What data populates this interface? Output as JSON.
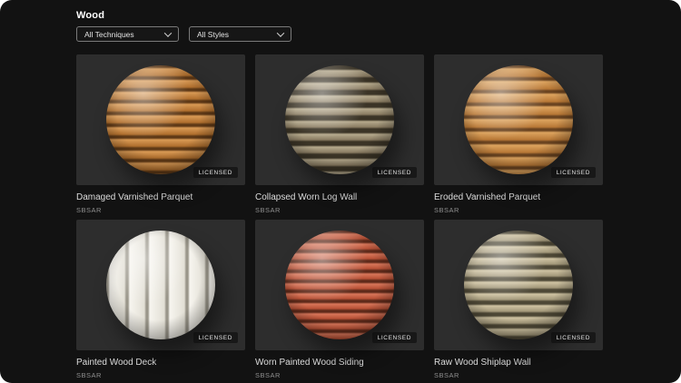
{
  "header": {
    "title": "Wood"
  },
  "filters": {
    "techniques": {
      "label": "All Techniques"
    },
    "styles": {
      "label": "All Styles"
    }
  },
  "cards": [
    {
      "title": "Damaged Varnished Parquet",
      "format": "SBSAR",
      "badge": "LICENSED",
      "sphere": {
        "light": "#d99a55",
        "base": "#b06f2e",
        "dark": "#5f3916",
        "direction": "horizontal",
        "plank": "11px",
        "groove": "2px"
      }
    },
    {
      "title": "Collapsed Worn Log Wall",
      "format": "SBSAR",
      "badge": "LICENSED",
      "sphere": {
        "light": "#b5a98c",
        "base": "#8a7c62",
        "dark": "#3b3426",
        "direction": "horizontal",
        "plank": "10px",
        "groove": "4px"
      }
    },
    {
      "title": "Eroded Varnished Parquet",
      "format": "SBSAR",
      "badge": "LICENSED",
      "sphere": {
        "light": "#dda45f",
        "base": "#b87836",
        "dark": "#6b4420",
        "direction": "horizontal",
        "plank": "12px",
        "groove": "2px"
      }
    },
    {
      "title": "Painted Wood Deck",
      "format": "SBSAR",
      "badge": "LICENSED",
      "sphere": {
        "light": "#f7f5ef",
        "base": "#e2dfd5",
        "dark": "#9a968a",
        "direction": "vertical",
        "plank": "20px",
        "groove": "2px"
      }
    },
    {
      "title": "Worn Painted Wood Siding",
      "format": "SBSAR",
      "badge": "LICENSED",
      "sphere": {
        "light": "#d8765a",
        "base": "#b85136",
        "dark": "#5f2a1a",
        "direction": "horizontal",
        "plank": "9px",
        "groove": "2px"
      }
    },
    {
      "title": "Raw Wood Shiplap Wall",
      "format": "SBSAR",
      "badge": "LICENSED",
      "sphere": {
        "light": "#cfc3a2",
        "base": "#a3987a",
        "dark": "#4e4836",
        "direction": "horizontal",
        "plank": "10px",
        "groove": "3px"
      }
    }
  ]
}
